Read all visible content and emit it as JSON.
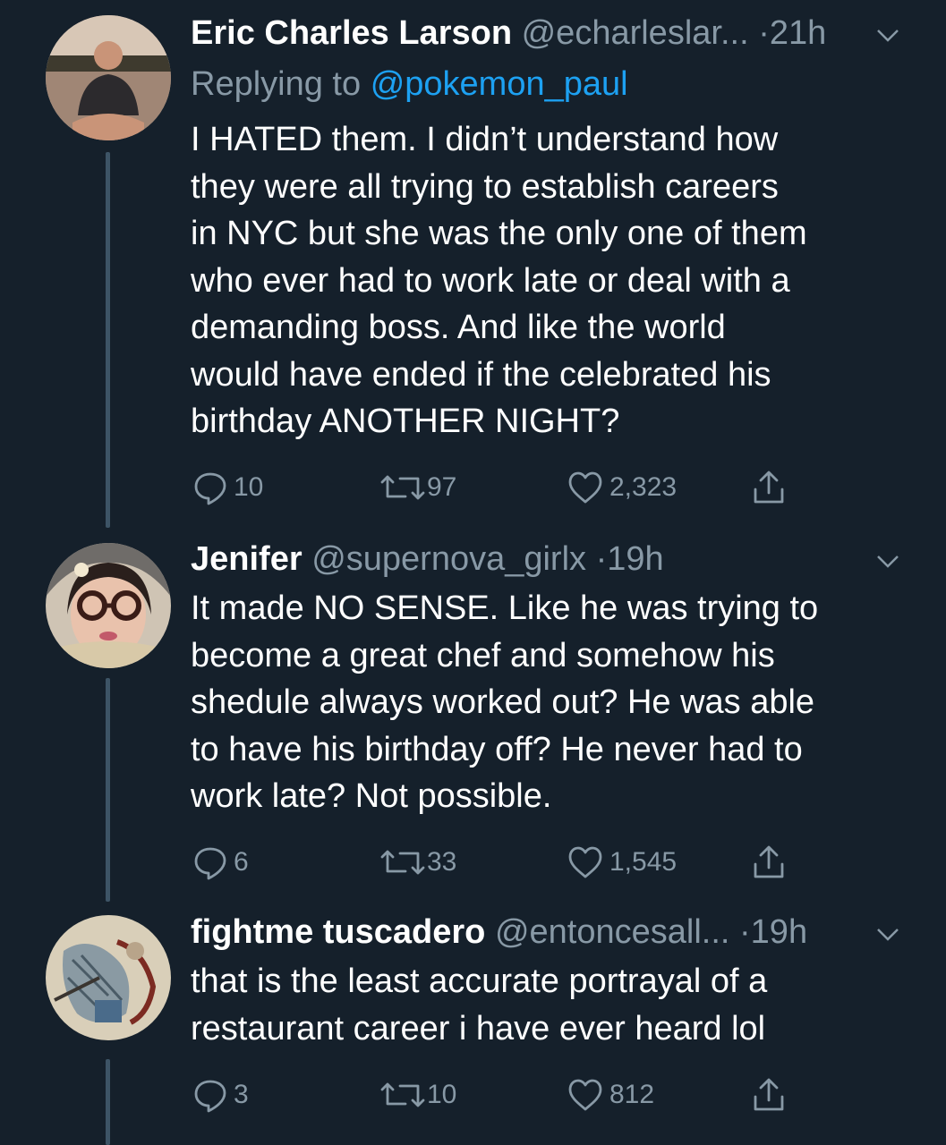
{
  "tweets": [
    {
      "name": "Eric Charles Larson",
      "handle": "@echarleslar...",
      "separator": "·",
      "time": "21h",
      "replying_label": "Replying to",
      "replying_to": "@pokemon_paul",
      "text": "I HATED them.  I didn’t understand how\nthey were all trying to establish careers\nin NYC but she was the only one of them\nwho ever had to work late or deal with a\ndemanding boss.  And like the world\nwould have ended if the celebrated his\nbirthday ANOTHER NIGHT?",
      "replies": "10",
      "retweets": "97",
      "likes": "2,323"
    },
    {
      "name": "Jenifer",
      "handle": "@supernova_girlx",
      "separator": "·",
      "time": "19h",
      "text": "It made NO SENSE. Like he was trying to\nbecome a great chef and somehow his\nshedule always worked out? He was able\nto have his birthday off? He never had to\nwork late? Not possible.",
      "replies": "6",
      "retweets": "33",
      "likes": "1,545"
    },
    {
      "name": "fightme tuscadero",
      "handle": "@entoncesall...",
      "separator": "·",
      "time": "19h",
      "text": "that is the least accurate portrayal of a\nrestaurant career i have ever heard lol",
      "replies": "3",
      "retweets": "10",
      "likes": "812"
    }
  ],
  "colors": {
    "background": "#15202b",
    "secondary_text": "#8899a6",
    "link": "#1da1f2",
    "thread_line": "#3d5466"
  },
  "icons": [
    "reply-icon",
    "retweet-icon",
    "like-icon",
    "share-icon",
    "chevron-down-icon"
  ]
}
